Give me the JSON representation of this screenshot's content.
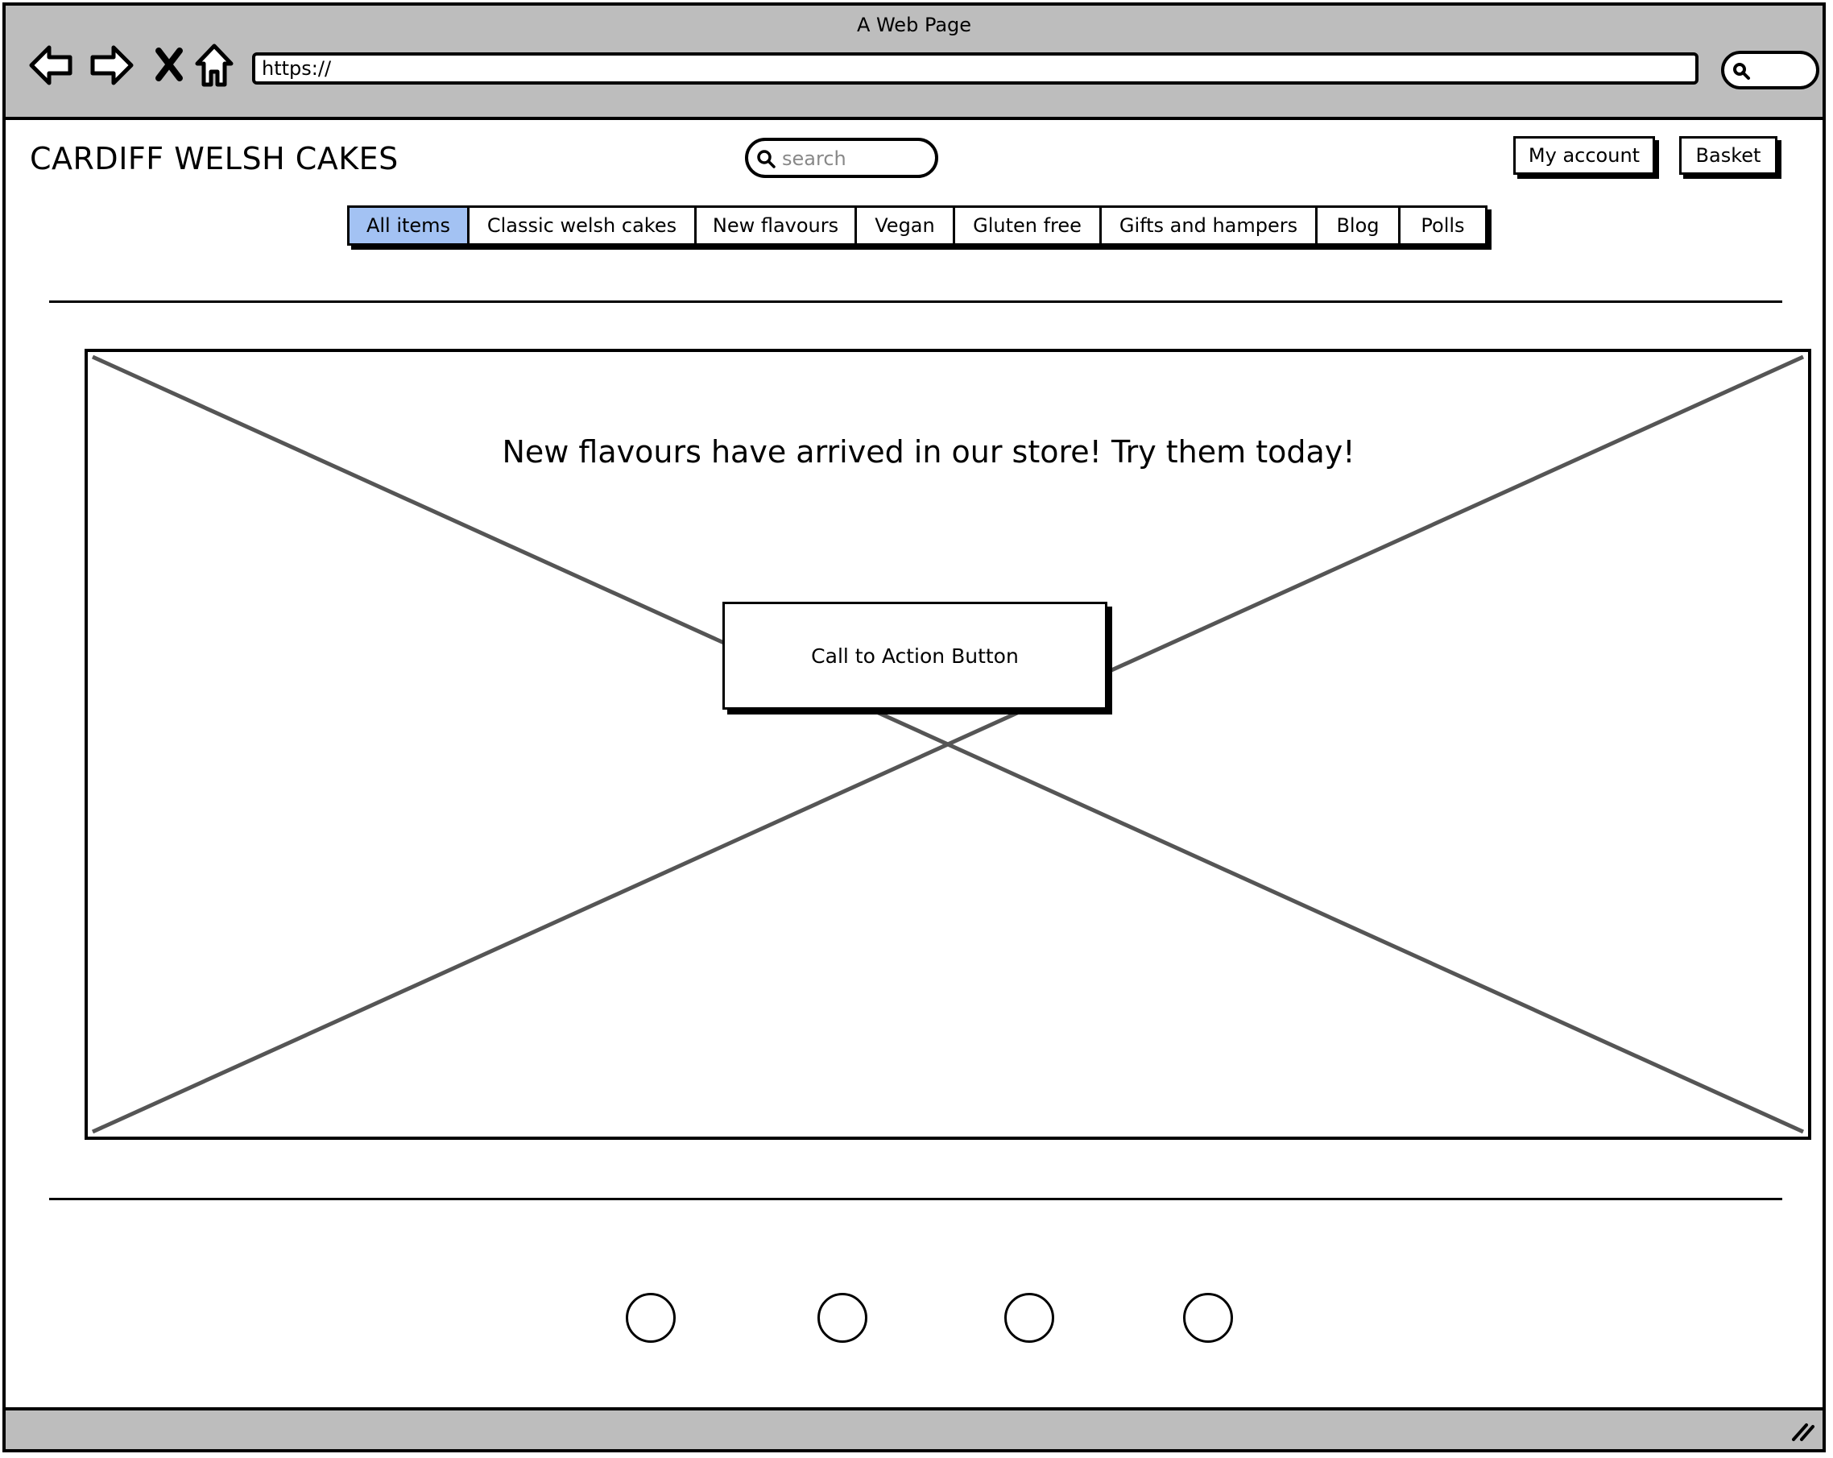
{
  "window": {
    "title": "A Web Page",
    "url": "https://"
  },
  "header": {
    "brand": "CARDIFF WELSH CAKES",
    "search_placeholder": "search",
    "my_account_label": "My account",
    "basket_label": "Basket"
  },
  "nav": {
    "tabs": [
      {
        "label": "All items",
        "active": true
      },
      {
        "label": "Classic welsh cakes",
        "active": false
      },
      {
        "label": "New flavours",
        "active": false
      },
      {
        "label": "Vegan",
        "active": false
      },
      {
        "label": "Gluten free",
        "active": false
      },
      {
        "label": "Gifts and hampers",
        "active": false
      },
      {
        "label": "Blog",
        "active": false
      },
      {
        "label": "Polls",
        "active": false
      }
    ],
    "active_color": "#a3c2f3"
  },
  "hero": {
    "headline": "New flavours have arrived in our store! Try them today!",
    "cta_label": "Call to Action Button"
  },
  "carousel": {
    "dot_count": 4
  },
  "icons": [
    "back-arrow-icon",
    "forward-arrow-icon",
    "close-icon",
    "home-icon",
    "search-icon",
    "resize-grip-icon"
  ]
}
